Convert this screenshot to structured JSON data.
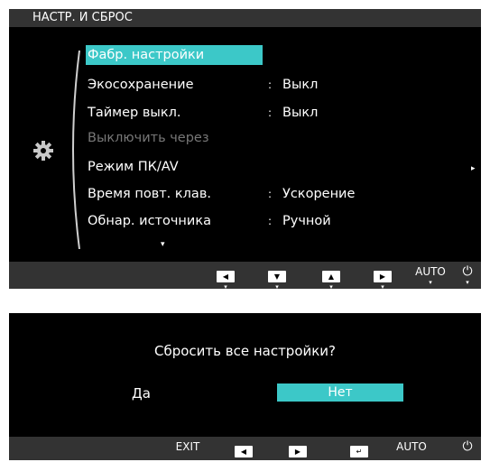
{
  "menu": {
    "title": "НАСТР. И СБРОС",
    "items": [
      {
        "label": "Фабр. настройки",
        "value": ""
      },
      {
        "label": "Экосохранение",
        "value": "Выкл"
      },
      {
        "label": "Таймер выкл.",
        "value": "Выкл"
      },
      {
        "label": "Выключить через",
        "value": ""
      },
      {
        "label": "Режим ПК/AV",
        "value": ""
      },
      {
        "label": "Время повт. клав.",
        "value": "Ускорение"
      },
      {
        "label": "Обнар. источника",
        "value": "Ручной"
      }
    ],
    "submenu_arrow": "▸",
    "scroll_arrow": "▾",
    "buttons": [
      {
        "icon": "left-icon",
        "glyph": "◀",
        "sub": "▾"
      },
      {
        "icon": "down-icon",
        "glyph": "▼",
        "sub": "▾"
      },
      {
        "icon": "up-icon",
        "glyph": "▲",
        "sub": "▾"
      },
      {
        "icon": "right-icon",
        "glyph": "▶",
        "sub": "▾"
      },
      {
        "label": "AUTO",
        "sub": "▾"
      },
      {
        "icon": "power-icon",
        "glyph": "⏻",
        "sub": "▾"
      }
    ]
  },
  "dialog": {
    "question": "Сбросить все настройки?",
    "yes": "Да",
    "no": "Нет",
    "buttons": [
      {
        "label": "EXIT"
      },
      {
        "icon": "left-icon",
        "glyph": "◀"
      },
      {
        "icon": "right-icon",
        "glyph": "▶"
      },
      {
        "icon": "enter-icon",
        "glyph": "↵"
      },
      {
        "label": "AUTO"
      },
      {
        "icon": "power-icon",
        "glyph": "⏻"
      }
    ]
  },
  "colors": {
    "highlight": "#3cc8c8",
    "panel": "#000000",
    "bar": "#333333",
    "disabled": "#777777"
  }
}
